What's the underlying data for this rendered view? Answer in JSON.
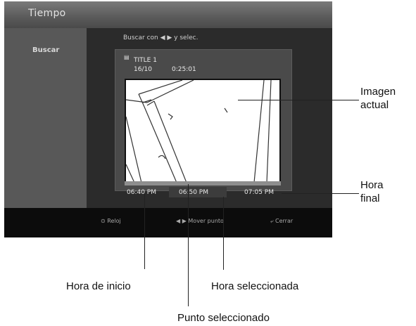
{
  "screen": {
    "title": "Tiempo",
    "sidebar_item": "Buscar",
    "hint": "Buscar con ◀ ▶ y selec.",
    "title_name": "TITLE 1",
    "title_date": "16/10",
    "title_time": "0:25:01",
    "time_start": "06:40 PM",
    "time_selected": "06:50 PM",
    "time_end": "07:05 PM",
    "bottom_clock": "⊙ Reloj",
    "bottom_move": "◀ ▶ Mover punto",
    "bottom_close": "⤶ Cerrar"
  },
  "callouts": {
    "image_line1": "Imagen",
    "image_line2": "actual",
    "end_line1": "Hora",
    "end_line2": "final",
    "start": "Hora de inicio",
    "selected_time": "Hora seleccionada",
    "selected_point": "Punto seleccionado"
  }
}
